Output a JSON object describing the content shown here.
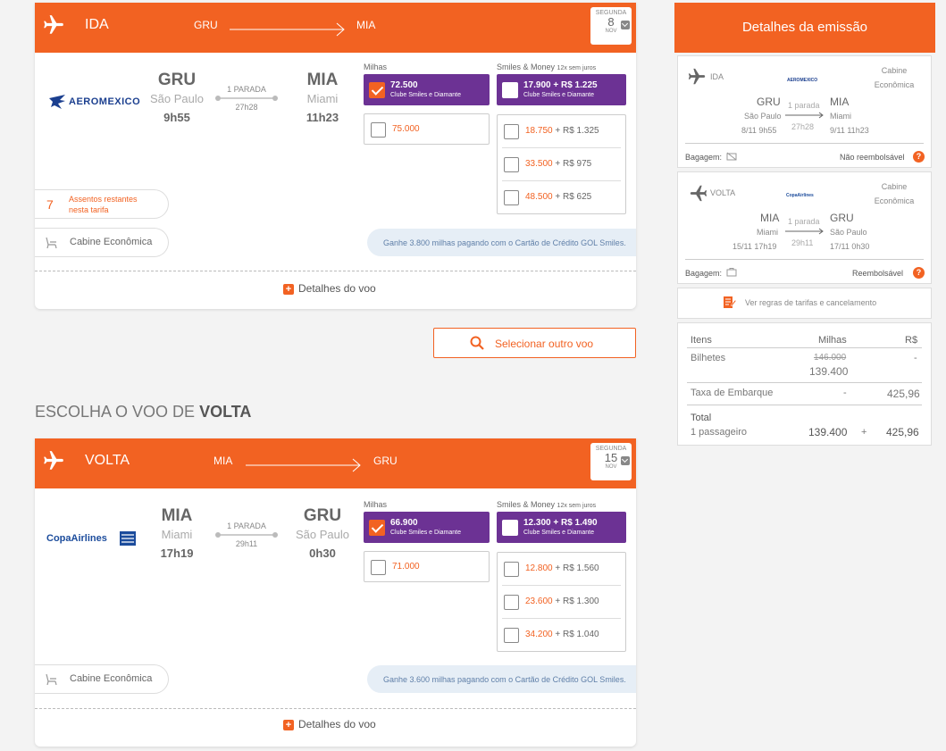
{
  "outbound": {
    "head_title": "IDA",
    "from": "GRU",
    "to": "MIA",
    "date": {
      "dow": "SEGUNDA",
      "day": "8",
      "month": "NOV"
    },
    "airline": "AEROMEXICO",
    "origin": {
      "code": "GRU",
      "city": "São Paulo",
      "time": "9h55"
    },
    "dest": {
      "code": "MIA",
      "city": "Miami",
      "time": "11h23"
    },
    "stops": "1 PARADA",
    "duration": "27h28",
    "miles_label": "Milhas",
    "sm_label": "Smiles & Money",
    "sm_installments": "12x sem juros",
    "miles_selected": {
      "value": "72.500",
      "sub": "Clube Smiles e Diamante"
    },
    "sm_selected": {
      "value": "17.900 + R$ 1.225",
      "sub": "Clube Smiles e Diamante"
    },
    "miles_other": "75.000",
    "sm_options": [
      {
        "miles": "18.750",
        "money": " + R$ 1.325"
      },
      {
        "miles": "33.500",
        "money": " + R$ 975"
      },
      {
        "miles": "48.500",
        "money": " + R$ 625"
      }
    ],
    "seats_num": "7",
    "seats_l1": "Assentos restantes",
    "seats_l2": "nesta tarifa",
    "cabin": "Cabine Econômica",
    "promo": "Ganhe 3.800 milhas pagando com o Cartão de Crédito GOL Smiles.",
    "details": "Detalhes do voo"
  },
  "select_other": "Selecionar outro voo",
  "section_title_prefix": "ESCOLHA O VOO DE ",
  "section_title_bold": "VOLTA",
  "inbound": {
    "head_title": "VOLTA",
    "from": "MIA",
    "to": "GRU",
    "date": {
      "dow": "SEGUNDA",
      "day": "15",
      "month": "NOV"
    },
    "airline": "CopaAirlines",
    "origin": {
      "code": "MIA",
      "city": "Miami",
      "time": "17h19"
    },
    "dest": {
      "code": "GRU",
      "city": "São Paulo",
      "time": "0h30"
    },
    "stops": "1 PARADA",
    "duration": "29h11",
    "miles_label": "Milhas",
    "sm_label": "Smiles & Money",
    "sm_installments": "12x sem juros",
    "miles_selected": {
      "value": "66.900",
      "sub": "Clube Smiles e Diamante"
    },
    "sm_selected": {
      "value": "12.300 + R$ 1.490",
      "sub": "Clube Smiles e Diamante"
    },
    "miles_other": "71.000",
    "sm_options": [
      {
        "miles": "12.800",
        "money": " + R$ 1.560"
      },
      {
        "miles": "23.600",
        "money": " + R$ 1.300"
      },
      {
        "miles": "34.200",
        "money": " + R$ 1.040"
      }
    ],
    "cabin": "Cabine Econômica",
    "promo": "Ganhe 3.600 milhas pagando com o Cartão de Crédito GOL Smiles.",
    "details": "Detalhes do voo"
  },
  "panel": {
    "title": "Detalhes da emissão",
    "ida": {
      "label": "IDA",
      "airline": "AEROMEXICO",
      "cabin_l1": "Cabine",
      "cabin_l2": "Econômica",
      "from": "GRU",
      "from_city": "São Paulo",
      "from_dt": "8/11 9h55",
      "stops": "1 parada",
      "dur": "27h28",
      "to": "MIA",
      "to_city": "Miami",
      "to_dt": "9/11 11h23",
      "bag_label": "Bagagem:",
      "refund": "Não reembolsável"
    },
    "volta": {
      "label": "VOLTA",
      "airline": "CopaAirlines",
      "cabin_l1": "Cabine",
      "cabin_l2": "Econômica",
      "from": "MIA",
      "from_city": "Miami",
      "from_dt": "15/11 17h19",
      "stops": "1 parada",
      "dur": "29h11",
      "to": "GRU",
      "to_city": "São Paulo",
      "to_dt": "17/11 0h30",
      "bag_label": "Bagagem:",
      "refund": "Reembolsável"
    },
    "rules": "Ver regras de tarifas e cancelamento",
    "table": {
      "h_items": "Itens",
      "h_miles": "Milhas",
      "h_money": "R$",
      "tickets": "Bilhetes",
      "tickets_old": "146.000",
      "tickets_miles": "139.400",
      "tickets_money": "-",
      "tax": "Taxa de Embarque",
      "tax_miles": "-",
      "tax_money": "425,96",
      "total": "Total",
      "pax": "1 passageiro",
      "total_miles": "139.400",
      "plus": "+",
      "total_money": "425,96"
    }
  }
}
